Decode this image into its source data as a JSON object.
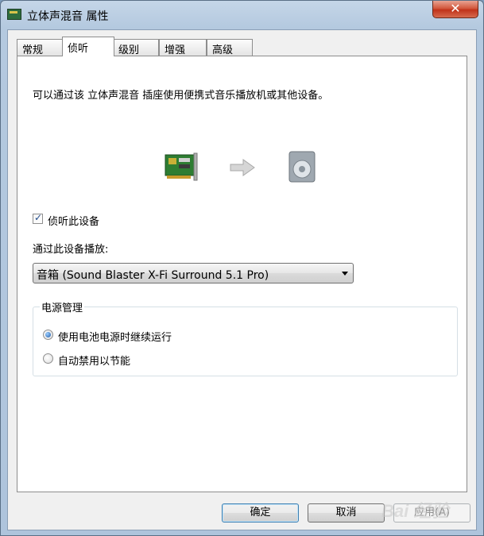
{
  "window": {
    "title": "立体声混音 属性",
    "close_glyph": "✕"
  },
  "tabs": [
    {
      "label": "常规",
      "active": false
    },
    {
      "label": "侦听",
      "active": true
    },
    {
      "label": "级别",
      "active": false
    },
    {
      "label": "增强",
      "active": false
    },
    {
      "label": "高级",
      "active": false
    }
  ],
  "listen": {
    "description": "可以通过该 立体声混音 插座使用便携式音乐播放机或其他设备。",
    "listen_checkbox": {
      "label": "侦听此设备",
      "checked": true
    },
    "playback_label": "通过此设备播放:",
    "playback_device": "音箱 (Sound Blaster X-Fi Surround 5.1 Pro)"
  },
  "power": {
    "title": "电源管理",
    "options": [
      {
        "label": "使用电池电源时继续运行",
        "selected": true
      },
      {
        "label": "自动禁用以节能",
        "selected": false
      }
    ]
  },
  "buttons": {
    "ok": "确定",
    "cancel": "取消",
    "apply": "应用(A)"
  },
  "watermark": "Bai 经验",
  "colors": {
    "close_red": "#c0321a",
    "default_button_border": "#3c7fb1",
    "radio_selected": "#1e5aa8"
  }
}
